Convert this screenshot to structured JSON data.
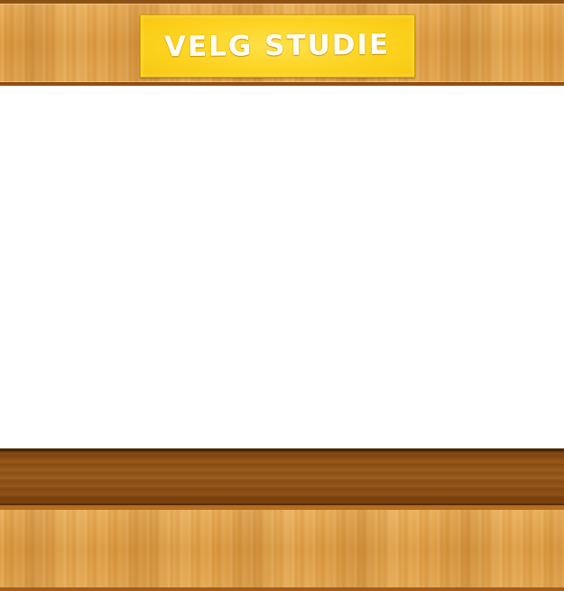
{
  "header": {
    "title": "VELG STUDIE"
  },
  "content": {},
  "shelf": {},
  "footer": {}
}
